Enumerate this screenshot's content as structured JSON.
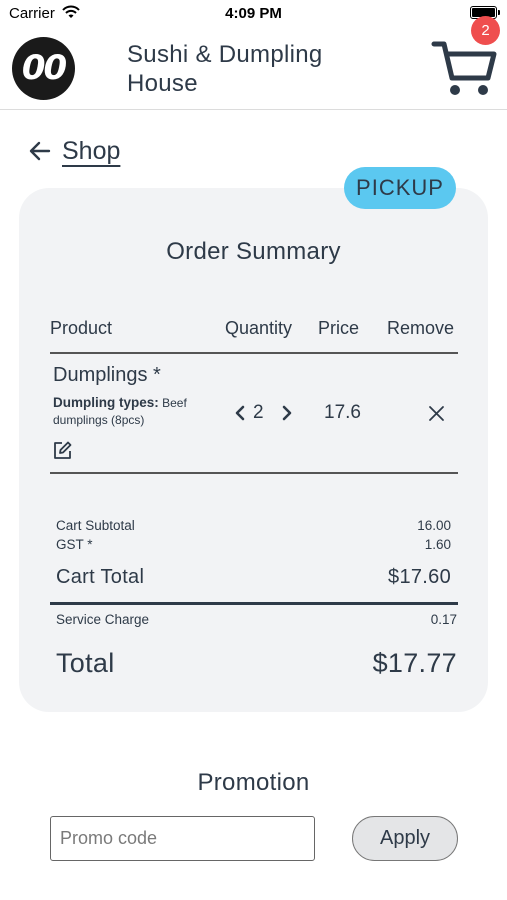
{
  "status_bar": {
    "carrier": "Carrier",
    "time": "4:09 PM"
  },
  "header": {
    "logo_text": "00",
    "title": "Sushi & Dumpling House",
    "cart_count": "2",
    "cart_icon": "shopping-cart-icon"
  },
  "nav": {
    "back_label": "Shop",
    "back_icon": "arrow-left-icon"
  },
  "order": {
    "fulfillment_badge": "PICKUP",
    "title": "Order Summary",
    "columns": {
      "product": "Product",
      "quantity": "Quantity",
      "price": "Price",
      "remove": "Remove"
    },
    "items": [
      {
        "name": "Dumplings *",
        "option_label": "Dumpling types:",
        "option_value": "Beef dumplings (8pcs)",
        "quantity": "2",
        "price": "17.6"
      }
    ],
    "totals": {
      "subtotal_label": "Cart Subtotal",
      "subtotal_value": "16.00",
      "gst_label": "GST *",
      "gst_value": "1.60",
      "cart_total_label": "Cart Total",
      "cart_total_value": "$17.60",
      "service_label": "Service Charge",
      "service_value": "0.17",
      "total_label": "Total",
      "total_value": "$17.77"
    }
  },
  "promotion": {
    "title": "Promotion",
    "placeholder": "Promo code",
    "value": "",
    "apply_label": "Apply"
  },
  "colors": {
    "text": "#2e3a48",
    "card_bg": "#f2f3f5",
    "pickup_badge": "#5bc8f0",
    "cart_badge": "#ef4e4e"
  }
}
